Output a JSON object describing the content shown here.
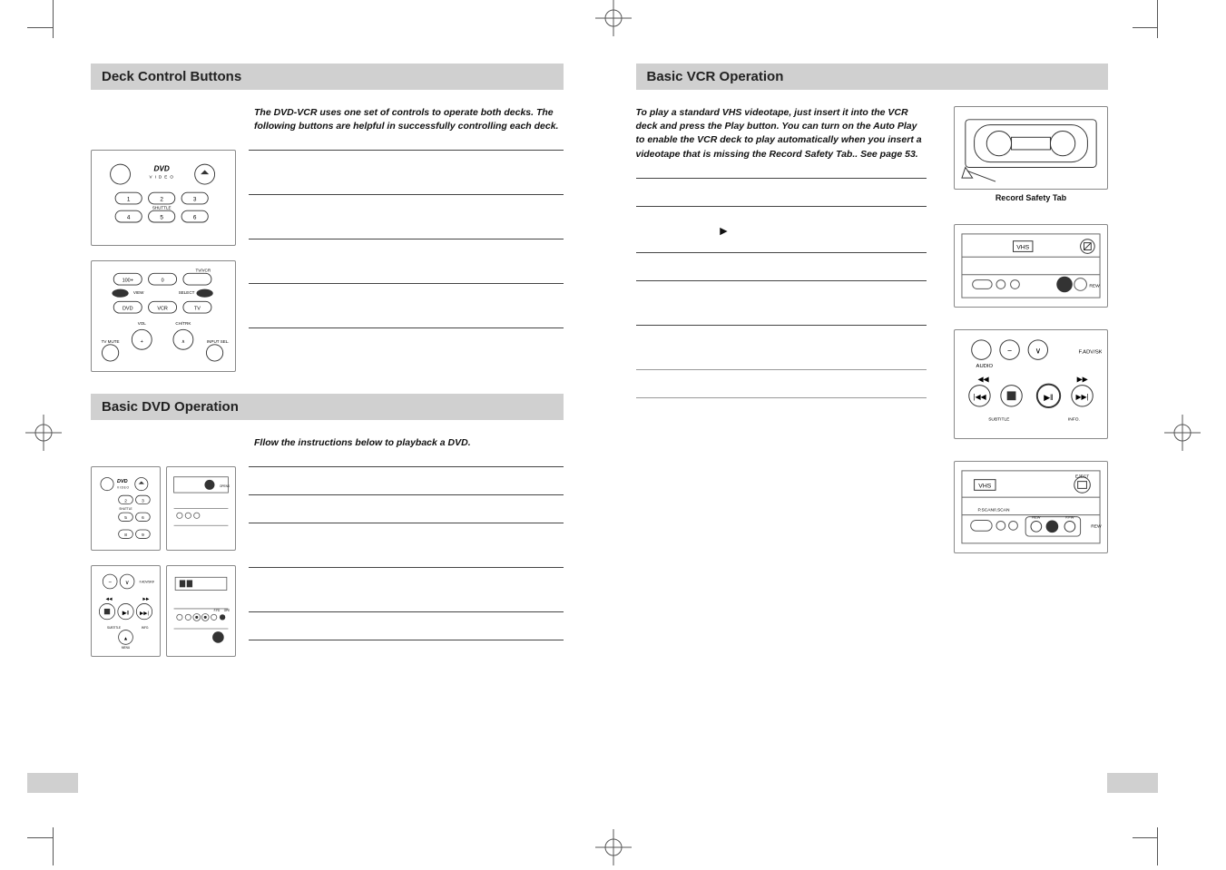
{
  "left": {
    "section1_title": "Deck Control Buttons",
    "section1_intro": "The DVD-VCR uses one set of controls to operate both decks. The following buttons are helpful in successfully controlling each deck.",
    "section2_title": "Basic DVD Operation",
    "section2_intro": "Fllow the instructions below to playback a DVD."
  },
  "right": {
    "section_title": "Basic VCR Operation",
    "intro": "To play a standard VHS videotape, just insert it into the VCR deck and press the Play button. You can turn on the Auto Play to enable the VCR deck to play automatically when you insert a videotape that is missing the Record Safety Tab.. See page 53.",
    "fig1_caption": "Record Safety Tab",
    "play_symbol": "►"
  },
  "icons": {
    "dvd_logo": "DVD",
    "vhs_logo": "VHS"
  }
}
